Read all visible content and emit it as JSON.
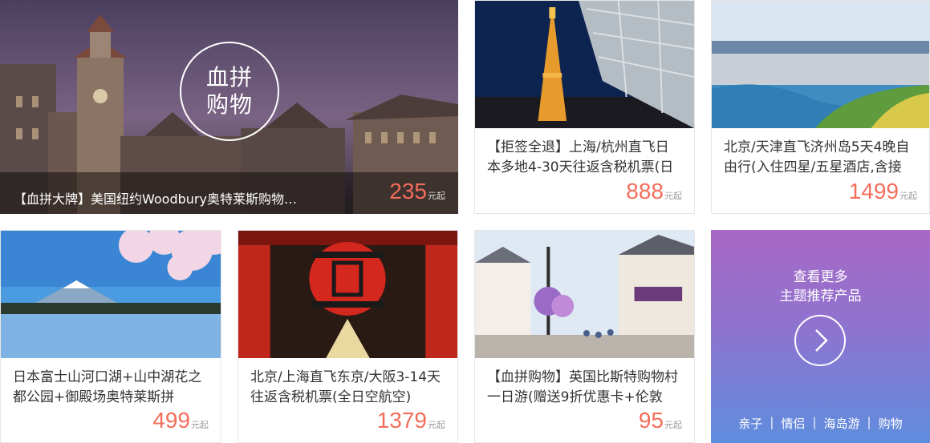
{
  "feature": {
    "badge_line1": "血拼",
    "badge_line2": "购物",
    "title": "【血拼大牌】美国纽约Woodbury奥特莱斯购物…",
    "price": "235",
    "unit": "元起"
  },
  "cards": [
    {
      "title": "【拒签全退】上海/杭州直飞日本多地4-30天往返含税机票(日",
      "price": "888",
      "unit": "元起"
    },
    {
      "title": "北京/天津直飞济州岛5天4晚自由行(入住四星/五星酒店,含接",
      "price": "1499",
      "unit": "元起"
    },
    {
      "title": "日本富士山河口湖+山中湖花之都公园+御殿场奥特莱斯拼",
      "price": "499",
      "unit": "元起"
    },
    {
      "title": "北京/上海直飞东京/大阪3-14天往返含税机票(全日空航空)",
      "price": "1379",
      "unit": "元起"
    },
    {
      "title": "【血拼购物】英国比斯特购物村一日游(赠送9折优惠卡+伦敦",
      "price": "95",
      "unit": "元起"
    }
  ],
  "more": {
    "line1": "查看更多",
    "line2": "主题推荐产品",
    "tags": [
      "亲子",
      "情侣",
      "海岛游",
      "购物"
    ],
    "separator": "|"
  }
}
